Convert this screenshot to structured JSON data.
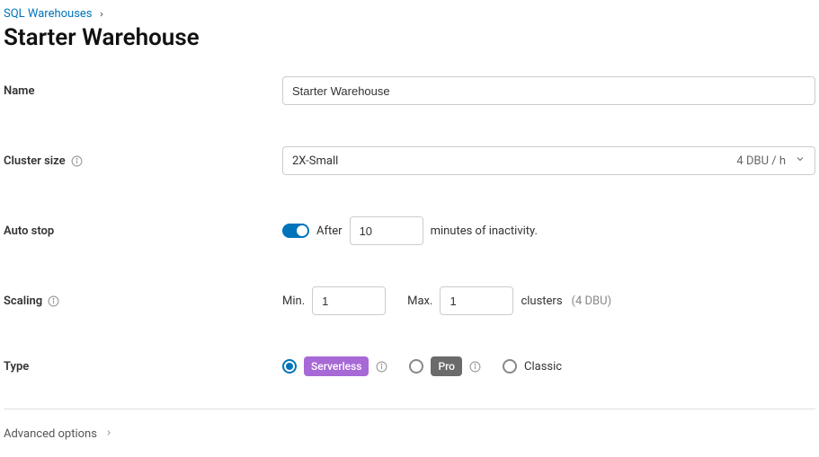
{
  "breadcrumb": {
    "parent": "SQL Warehouses"
  },
  "page_title": "Starter Warehouse",
  "fields": {
    "name": {
      "label": "Name",
      "value": "Starter Warehouse"
    },
    "cluster_size": {
      "label": "Cluster size",
      "value": "2X-Small",
      "cost": "4 DBU / h"
    },
    "auto_stop": {
      "label": "Auto stop",
      "enabled": true,
      "prefix": "After",
      "minutes": "10",
      "suffix": "minutes of inactivity."
    },
    "scaling": {
      "label": "Scaling",
      "min_label": "Min.",
      "min_value": "1",
      "max_label": "Max.",
      "max_value": "1",
      "clusters_label": "clusters",
      "note": "(4 DBU)"
    },
    "type": {
      "label": "Type",
      "options": {
        "serverless": "Serverless",
        "pro": "Pro",
        "classic": "Classic"
      },
      "selected": "serverless"
    }
  },
  "advanced_label": "Advanced options"
}
